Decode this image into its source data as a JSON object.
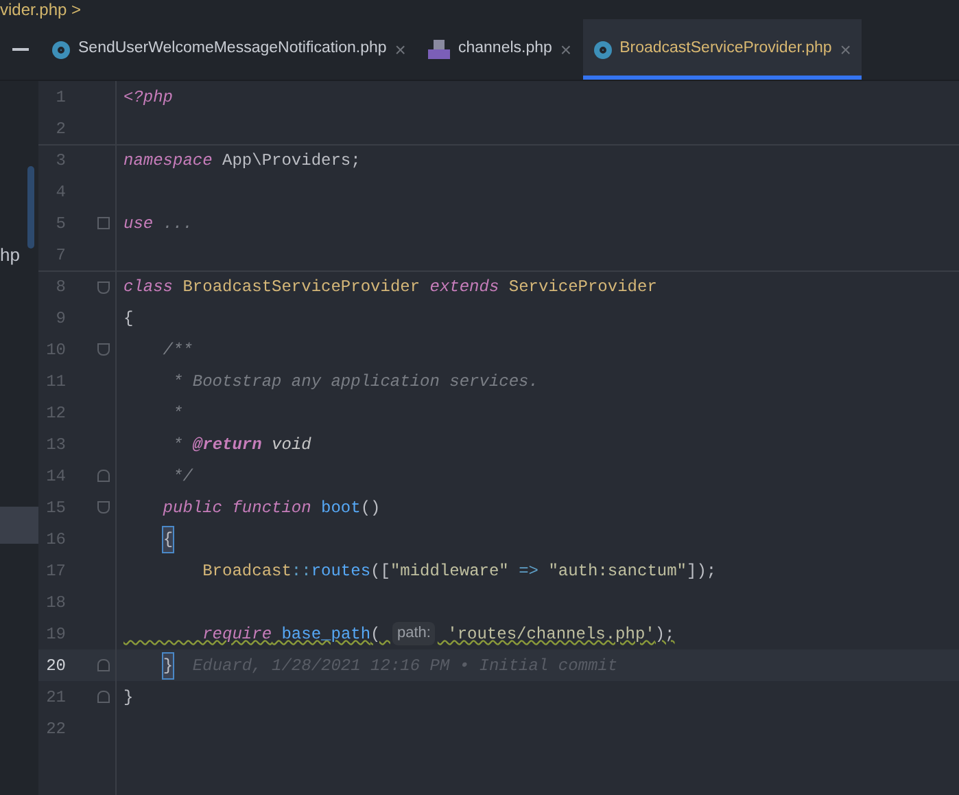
{
  "breadcrumb": {
    "text": "vider.php",
    "arrow": ">"
  },
  "sidebar": {
    "item_text": "hp"
  },
  "tabs": [
    {
      "label": "SendUserWelcomeMessageNotification.php",
      "kind": "class",
      "selected": false,
      "close": "×"
    },
    {
      "label": "channels.php",
      "kind": "php",
      "selected": false,
      "close": "×"
    },
    {
      "label": "BroadcastServiceProvider.php",
      "kind": "class",
      "selected": true,
      "close": "×"
    }
  ],
  "lines": [
    {
      "number": "1",
      "current": false,
      "separator_above": false,
      "warning": false,
      "tokens": [
        {
          "kind": "kw",
          "text": "<?php"
        }
      ]
    },
    {
      "number": "2",
      "current": false,
      "separator_above": false
    },
    {
      "number": "3",
      "current": false,
      "separator_above": true,
      "warning": false,
      "tokens": [
        {
          "kind": "kw",
          "text": "namespace"
        },
        {
          "kind": "plain",
          "text": " App\\Providers;"
        }
      ]
    },
    {
      "number": "4",
      "current": false,
      "separator_above": false
    },
    {
      "number": "5",
      "current": false,
      "separator_above": false,
      "warning": false,
      "marker": {
        "kind": "folded"
      },
      "tokens": [
        {
          "kind": "kw",
          "text": "use"
        },
        {
          "kind": "cmt",
          "text": " ..."
        }
      ]
    },
    {
      "number": "7",
      "current": false,
      "separator_above": false
    },
    {
      "number": "8",
      "current": false,
      "separator_above": true,
      "warning": false,
      "marker": {
        "kind": "start"
      },
      "tokens": [
        {
          "kind": "kw",
          "text": "class"
        },
        {
          "kind": "cls",
          "text": " BroadcastServiceProvider "
        },
        {
          "kind": "kw",
          "text": "extends"
        },
        {
          "kind": "cls",
          "text": " ServiceProvider"
        }
      ]
    },
    {
      "number": "9",
      "current": false,
      "separator_above": false,
      "warning": false,
      "tokens": [
        {
          "kind": "plain",
          "text": "{"
        }
      ]
    },
    {
      "number": "10",
      "current": false,
      "separator_above": false,
      "warning": false,
      "marker": {
        "kind": "start"
      },
      "tokens": [
        {
          "kind": "cmt",
          "text": "    /**"
        }
      ]
    },
    {
      "number": "11",
      "current": false,
      "separator_above": false,
      "warning": false,
      "tokens": [
        {
          "kind": "cmt",
          "text": "     * Bootstrap any application services."
        }
      ]
    },
    {
      "number": "12",
      "current": false,
      "separator_above": false,
      "warning": false,
      "tokens": [
        {
          "kind": "cmt",
          "text": "     *"
        }
      ]
    },
    {
      "number": "13",
      "current": false,
      "separator_above": false,
      "warning": false,
      "tokens": [
        {
          "kind": "cmt",
          "text": "     * "
        },
        {
          "kind": "tag",
          "text": "@return"
        },
        {
          "kind": "doc",
          "text": " void"
        }
      ]
    },
    {
      "number": "14",
      "current": false,
      "separator_above": false,
      "warning": false,
      "marker": {
        "kind": "end"
      },
      "tokens": [
        {
          "kind": "cmt",
          "text": "     */"
        }
      ]
    },
    {
      "number": "15",
      "current": false,
      "separator_above": false,
      "warning": false,
      "marker": {
        "kind": "start"
      },
      "tokens": [
        {
          "kind": "kw",
          "text": "    public function"
        },
        {
          "kind": "fn",
          "text": " boot"
        },
        {
          "kind": "plain",
          "text": "()"
        }
      ]
    },
    {
      "number": "16",
      "current": false,
      "separator_above": false,
      "warning": false,
      "tokens": [
        {
          "kind": "brace",
          "text": "{"
        }
      ]
    },
    {
      "number": "17",
      "current": false,
      "separator_above": false,
      "warning": false,
      "tokens": [
        {
          "kind": "cls",
          "text": "        Broadcast"
        },
        {
          "kind": "op",
          "text": "::"
        },
        {
          "kind": "fn",
          "text": "routes"
        },
        {
          "kind": "plain",
          "text": "(["
        },
        {
          "kind": "str",
          "text": "\"middleware\""
        },
        {
          "kind": "op",
          "text": " => "
        },
        {
          "kind": "str",
          "text": "\"auth:sanctum\""
        },
        {
          "kind": "plain",
          "text": "]);"
        }
      ]
    },
    {
      "number": "18",
      "current": false,
      "separator_above": false
    },
    {
      "number": "19",
      "current": false,
      "separator_above": false,
      "warning": true,
      "tokens": [
        {
          "kind": "kw",
          "text": "        require"
        },
        {
          "kind": "fn",
          "text": " base_path"
        },
        {
          "kind": "plain",
          "text": "( "
        },
        {
          "kind": "hint",
          "text": "path:"
        },
        {
          "kind": "str",
          "text": " 'routes/channels.php'"
        },
        {
          "kind": "plain",
          "text": ");"
        }
      ]
    },
    {
      "number": "20",
      "current": true,
      "separator_above": false,
      "warning": false,
      "marker": {
        "kind": "end"
      },
      "tokens": [
        {
          "kind": "brace",
          "text": "}"
        },
        {
          "kind": "blame",
          "text": "  Eduard, 1/28/2021 12:16 PM • Initial commit"
        }
      ]
    },
    {
      "number": "21",
      "current": false,
      "separator_above": false,
      "warning": false,
      "marker": {
        "kind": "end"
      },
      "tokens": [
        {
          "kind": "plain",
          "text": "}"
        }
      ]
    },
    {
      "number": "22",
      "current": false,
      "separator_above": false
    }
  ]
}
